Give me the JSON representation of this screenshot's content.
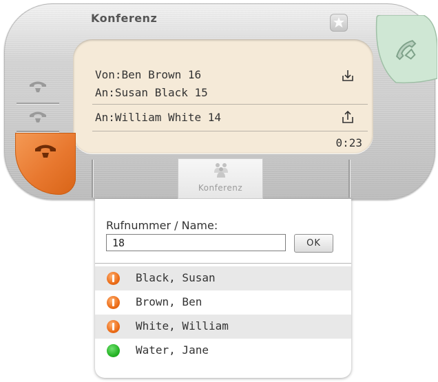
{
  "header": {
    "title": "Konferenz"
  },
  "call": {
    "from_line": "Von:Ben Brown 16",
    "to_line": "An:Susan Black 15",
    "conf_line": "An:William White 14",
    "duration": "0:23"
  },
  "tabs": {
    "conference_label": "Konferenz"
  },
  "search": {
    "label": "Rufnummer / Name:",
    "value": "18",
    "ok_label": "OK"
  },
  "contacts": [
    {
      "name": "Black, Susan",
      "status": "busy"
    },
    {
      "name": "Brown, Ben",
      "status": "busy"
    },
    {
      "name": "White, William",
      "status": "busy"
    },
    {
      "name": "Water, Jane",
      "status": "available"
    }
  ],
  "colors": {
    "panel_bg": "#f5ead8",
    "hangup_orange": "#e8782f",
    "status_busy": "#ec6d18",
    "status_available": "#26b426",
    "call_green": "#cfe7d4"
  },
  "icons": {
    "close": "close-icon",
    "call": "phone-pickup-icon",
    "line": "handset-icon",
    "hangup": "hangup-icon",
    "incoming": "download-tray-icon",
    "outgoing": "upload-tray-icon",
    "conference": "conference-people-icon"
  }
}
